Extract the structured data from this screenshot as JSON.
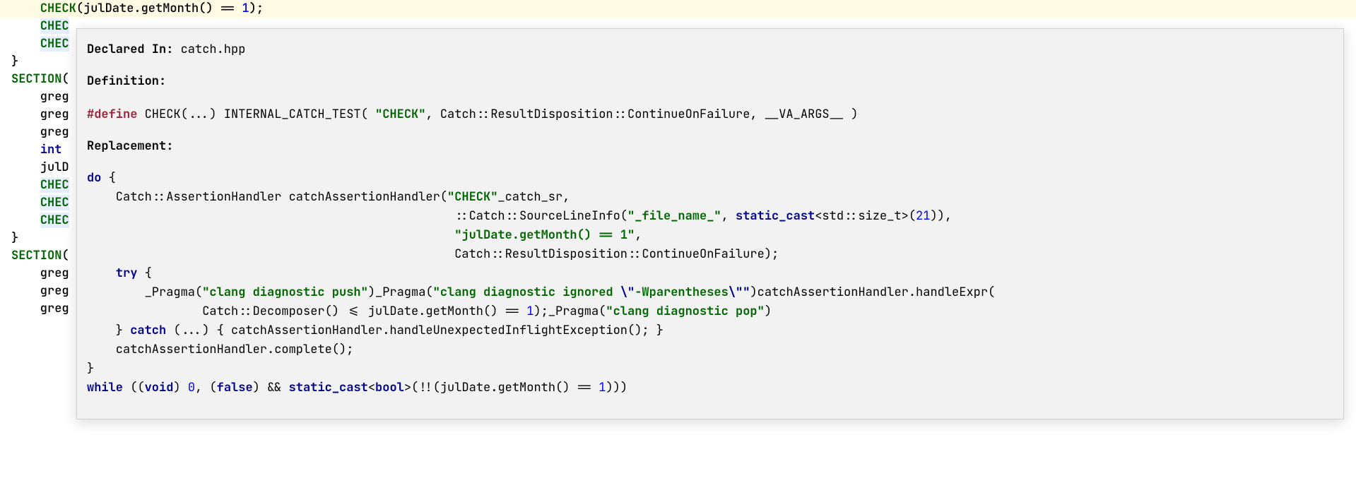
{
  "code": {
    "l1_a": "    ",
    "l1_macro": "CHECK",
    "l1_b": "(julDate.getMonth() == ",
    "l1_num": "1",
    "l1_c": ");",
    "l2_indent": "    ",
    "l2_macro": "CHEC",
    "l3_indent": "    ",
    "l3_macro": "CHEC",
    "l4": "}",
    "l5": "",
    "l6_macro": "SECTION",
    "l6_rest": "(",
    "l7": "    greg",
    "l8": "    greg",
    "l9": "    greg",
    "l10": "",
    "l11_kw": "int",
    "l11_rest": " ",
    "l11_indent": "    ",
    "l12": "    julD",
    "l13": "",
    "l14_indent": "    ",
    "l14_macro": "CHEC",
    "l15_indent": "    ",
    "l15_macro": "CHEC",
    "l16_indent": "    ",
    "l16_macro": "CHEC",
    "l17": "}",
    "l18": "",
    "l19_macro": "SECTION",
    "l19_rest": "(",
    "l20": "    greg",
    "l21": "    greg",
    "l22": "    greg"
  },
  "tooltip": {
    "declared_in_label": "Declared In:",
    "declared_in_value": " catch.hpp",
    "definition_label": "Definition:",
    "def_pp": "#define",
    "def_rest_a": " CHECK(...) INTERNAL_CATCH_TEST( ",
    "def_str": "\"CHECK\"",
    "def_rest_b": ", Catch::ResultDisposition::ContinueOnFailure, __VA_ARGS__ )",
    "replacement_label": "Replacement:",
    "r1_kw": "do",
    "r1_rest": " {",
    "r2_a": "    Catch::AssertionHandler catchAssertionHandler(",
    "r2_str": "\"CHECK\"",
    "r2_b": "_catch_sr,",
    "r3_a": "                                                   ::Catch::SourceLineInfo(",
    "r3_str": "\"_file_name_\"",
    "r3_b": ", ",
    "r3_kw": "static_cast",
    "r3_c": "<std::size_t>(",
    "r3_num": "21",
    "r3_d": ")),",
    "r4_a": "                                                   ",
    "r4_str": "\"julDate.getMonth() == 1\"",
    "r4_b": ",",
    "r5": "                                                   Catch::ResultDisposition::ContinueOnFailure);",
    "r6_indent": "    ",
    "r6_kw": "try",
    "r6_rest": " {",
    "r7_a": "        _Pragma(",
    "r7_str1": "\"clang diagnostic push\"",
    "r7_b": ")_Pragma(",
    "r7_str2": "\"clang diagnostic ignored ",
    "r7_esc": "\\\"",
    "r7_wp": "-Wparentheses",
    "r7_esc2": "\\\"\"",
    "r7_c": ")catchAssertionHandler.handleExpr(",
    "r8_a": "                Catch::Decomposer() <= julDate.getMonth() == ",
    "r8_num": "1",
    "r8_b": ");_Pragma(",
    "r8_str": "\"clang diagnostic pop\"",
    "r8_c": ")",
    "r9_a": "    } ",
    "r9_kw": "catch",
    "r9_b": " (...) { catchAssertionHandler.handleUnexpectedInflightException(); }",
    "r10": "    catchAssertionHandler.complete();",
    "r11": "}",
    "r12_kw1": "while",
    "r12_a": " ((",
    "r12_kw2": "void",
    "r12_b": ") ",
    "r12_num": "0",
    "r12_c": ", (",
    "r12_kw3": "false",
    "r12_d": ") && ",
    "r12_kw4": "static_cast",
    "r12_e": "<",
    "r12_kw5": "bool",
    "r12_f": ">(!!(julDate.getMonth() == ",
    "r12_num2": "1",
    "r12_g": ")))"
  }
}
